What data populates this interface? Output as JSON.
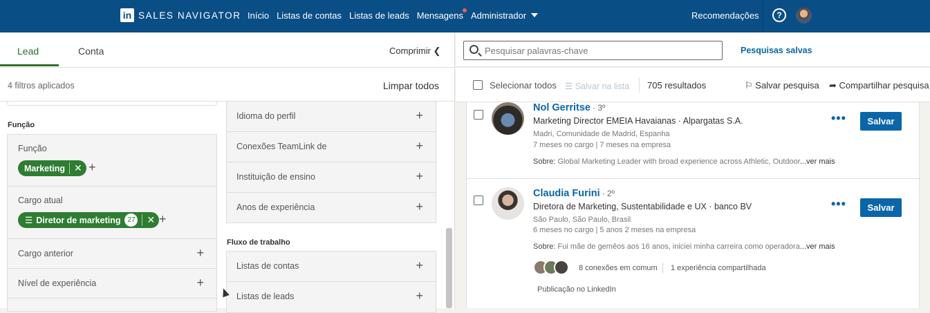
{
  "nav": {
    "logo": "in",
    "brand": "SALES NAVIGATOR",
    "links": [
      "Início",
      "Listas de contas",
      "Listas de leads",
      "Mensagens",
      "Administrador"
    ],
    "recommendations": "Recomendações",
    "help": "?"
  },
  "left": {
    "tabs": {
      "lead": "Lead",
      "account": "Conta"
    },
    "collapse": "Comprimir ❮",
    "filters_applied": "4 filtros aplicados",
    "clear_all": "Limpar todos",
    "function_section": "Função",
    "function_label": "Função",
    "function_pill": "Marketing",
    "current_title_label": "Cargo atual",
    "current_title_pill": "Diretor de marketing",
    "current_title_count": "27",
    "past_title": "Cargo anterior",
    "seniority": "Nível de experiência",
    "col2_rows": [
      "Idioma do perfil",
      "Conexões TeamLink de",
      "Instituição de ensino",
      "Anos de experiência"
    ],
    "workflow_section": "Fluxo de trabalho",
    "workflow_rows": [
      "Listas de contas",
      "Listas de leads"
    ]
  },
  "right": {
    "search_placeholder": "Pesquisar palavras-chave",
    "saved_searches": "Pesquisas salvas",
    "select_all": "Selecionar todos",
    "save_to_list": "Salvar na lista",
    "results": "705 resultados",
    "save_search": "Salvar pesquisa",
    "share_search": "Compartilhar pesquisa",
    "cards": [
      {
        "name": "Nol Gerritse",
        "degree": "· 3º",
        "title": "Marketing Director EMEIA Havaianas · Alpargatas S.A.",
        "location": "Madri, Comunidade de Madrid, Espanha",
        "tenure": "7 meses no cargo | 7 meses na empresa",
        "about_label": "Sobre:",
        "about": "Global Marketing Leader with broad experience across Athletic, Outdoor",
        "more": "...ver mais",
        "save": "Salvar"
      },
      {
        "name": "Claudia Furini",
        "degree": "· 2º",
        "title": "Diretora de Marketing, Sustentabilidade e UX · banco BV",
        "location": "São Paulo, São Paulo, Brasil",
        "tenure": "6 meses no cargo | 5 anos 2 meses na empresa",
        "about_label": "Sobre:",
        "about": "Fui mãe de gemêos aos 16 anos, iniciei minha carreira como operadora",
        "more": "...ver mais",
        "save": "Salvar",
        "connections": "8 conexões em comum",
        "shared_experience": "1 experiência compartilhada",
        "linkedin_posts": "Publicação no LinkedIn"
      }
    ]
  }
}
